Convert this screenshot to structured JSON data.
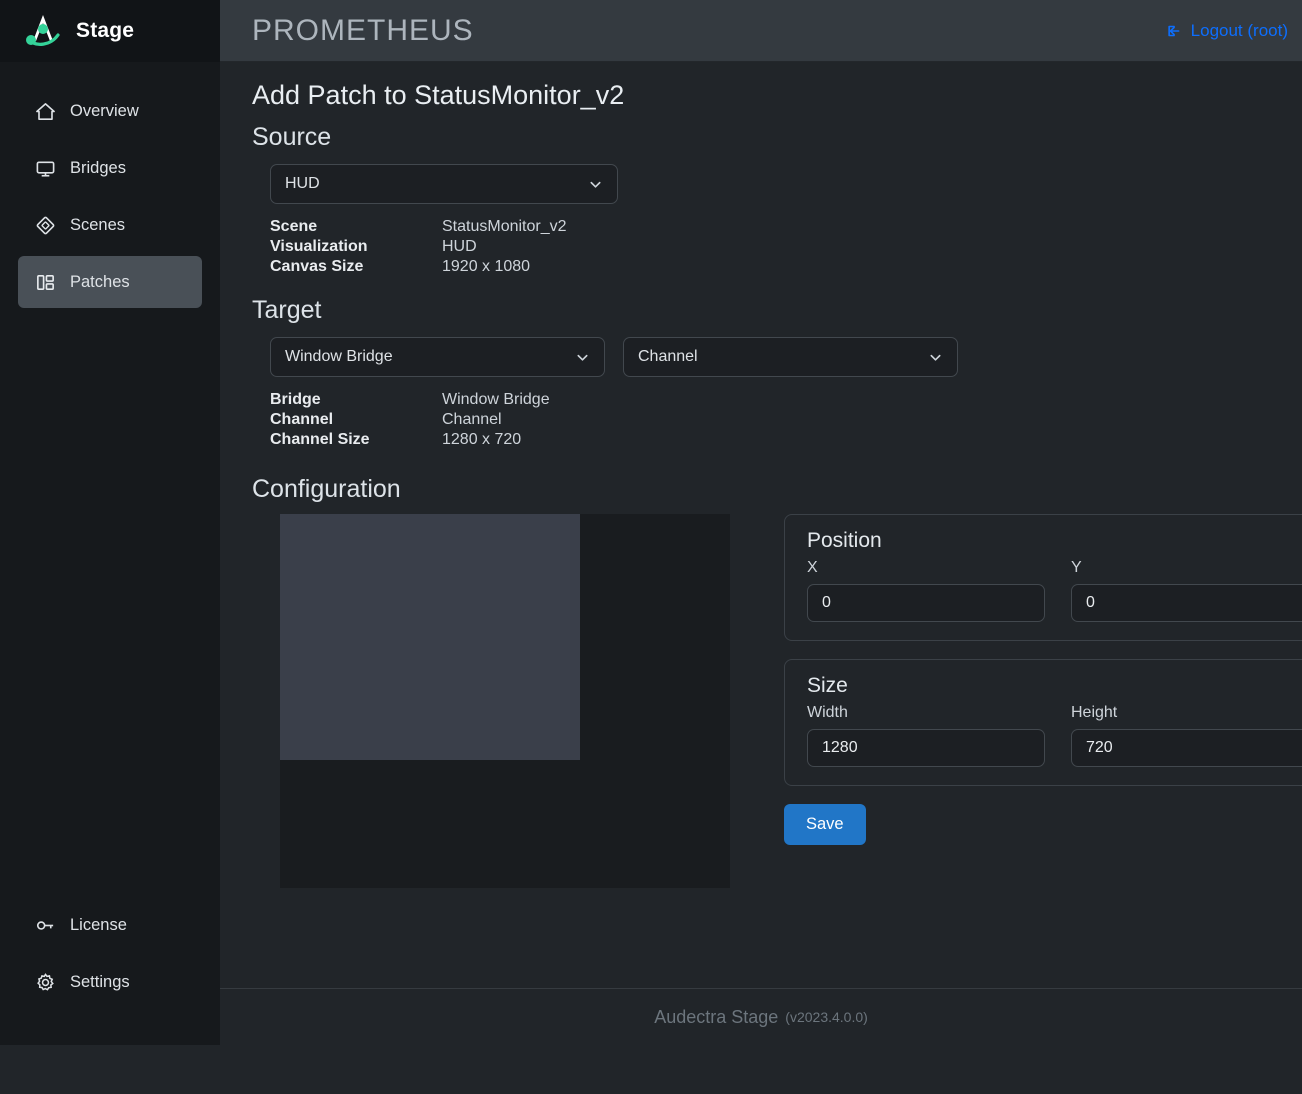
{
  "brand": {
    "name": "Stage",
    "logo_icon": "audectra-logo-icon"
  },
  "sidebar": {
    "top_items": [
      {
        "label": "Overview",
        "icon": "home-icon",
        "active": false
      },
      {
        "label": "Bridges",
        "icon": "monitor-icon",
        "active": false
      },
      {
        "label": "Scenes",
        "icon": "diamond-icon",
        "active": false
      },
      {
        "label": "Patches",
        "icon": "layout-panels-icon",
        "active": true
      }
    ],
    "bottom_items": [
      {
        "label": "License",
        "icon": "key-icon"
      },
      {
        "label": "Settings",
        "icon": "gear-icon"
      }
    ]
  },
  "header": {
    "title": "PROMETHEUS",
    "logout_label": "Logout (root)",
    "logout_icon": "sign-out-icon",
    "logout_color": "#0d6efd"
  },
  "main": {
    "page_title": "Add Patch to StatusMonitor_v2",
    "source": {
      "heading": "Source",
      "select_value": "HUD",
      "info": [
        {
          "key": "Scene",
          "value": "StatusMonitor_v2"
        },
        {
          "key": "Visualization",
          "value": "HUD"
        },
        {
          "key": "Canvas Size",
          "value": "1920 x 1080"
        }
      ]
    },
    "target": {
      "heading": "Target",
      "bridge_select_value": "Window Bridge",
      "channel_select_value": "Channel",
      "info": [
        {
          "key": "Bridge",
          "value": "Window Bridge"
        },
        {
          "key": "Channel",
          "value": "Channel"
        },
        {
          "key": "Channel Size",
          "value": "1280 x 720"
        }
      ]
    },
    "configuration": {
      "heading": "Configuration",
      "position": {
        "title": "Position",
        "x_label": "X",
        "x_value": "0",
        "y_label": "Y",
        "y_value": "0"
      },
      "size": {
        "title": "Size",
        "width_label": "Width",
        "width_value": "1280",
        "height_label": "Height",
        "height_value": "720"
      },
      "save_label": "Save",
      "save_color": "#2176c7"
    }
  },
  "footer": {
    "name": "Audectra Stage",
    "version": "(v2023.4.0.0)"
  }
}
